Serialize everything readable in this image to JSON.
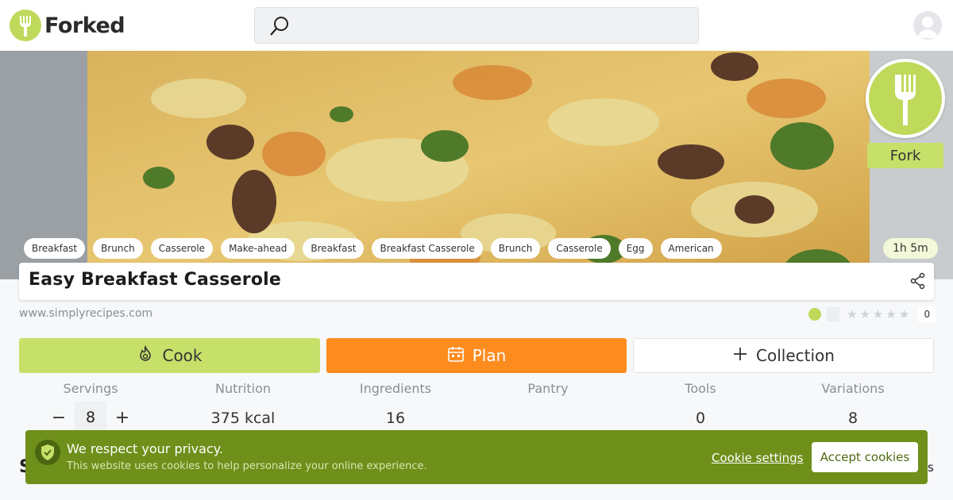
{
  "header": {
    "brand": "Forked",
    "search_placeholder": ""
  },
  "hero": {
    "fork_label": "Fork",
    "tags": [
      "Breakfast",
      "Brunch",
      "Casserole",
      "Make-ahead",
      "Breakfast",
      "Breakfast Casserole",
      "Brunch",
      "Casserole",
      "Egg",
      "American"
    ],
    "time": "1h 5m"
  },
  "recipe": {
    "title": "Easy Breakfast Casserole",
    "source": "www.simplyrecipes.com",
    "rating_count": "0"
  },
  "actions": {
    "cook": "Cook",
    "plan": "Plan",
    "collection": "Collection"
  },
  "stats": {
    "servings_label": "Servings",
    "servings_value": "8",
    "nutrition_label": "Nutrition",
    "nutrition_value": "375 kcal",
    "ingredients_label": "Ingredients",
    "ingredients_value": "16",
    "pantry_label": "Pantry",
    "pantry_value": "",
    "tools_label": "Tools",
    "tools_value": "0",
    "variations_label": "Variations",
    "variations_value": "8"
  },
  "cookie": {
    "title": "We respect your privacy.",
    "description": "This website uses cookies to help personalize your online experience.",
    "settings": "Cookie settings",
    "accept": "Accept cookies"
  },
  "colors": {
    "brand_green": "#bfd95a",
    "cook_green": "#c6e06a",
    "plan_orange": "#fd8c1f",
    "cookie_green": "#6e8f1a"
  }
}
